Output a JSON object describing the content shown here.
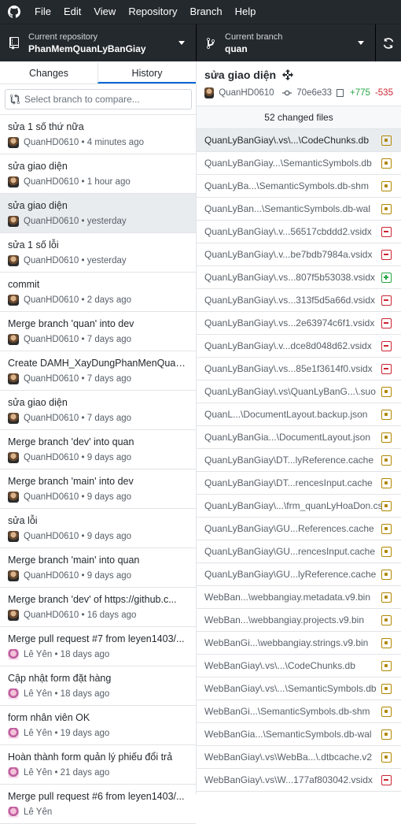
{
  "menu": {
    "items": [
      "File",
      "Edit",
      "View",
      "Repository",
      "Branch",
      "Help"
    ]
  },
  "toolbar": {
    "repo_label": "Current repository",
    "repo_value": "PhanMemQuanLyBanGiay",
    "branch_label": "Current branch",
    "branch_value": "quan"
  },
  "tabs": {
    "changes": "Changes",
    "history": "History"
  },
  "compare": {
    "placeholder": "Select branch to compare..."
  },
  "commits": [
    {
      "title": "sửa 1 số thứ nữa",
      "author": "QuanHD0610",
      "time": "4 minutes ago"
    },
    {
      "title": "sửa giao diện",
      "author": "QuanHD0610",
      "time": "1 hour ago"
    },
    {
      "title": "sửa giao diện",
      "author": "QuanHD0610",
      "time": "yesterday"
    },
    {
      "title": "sửa 1 số lỗi",
      "author": "QuanHD0610",
      "time": "yesterday"
    },
    {
      "title": "commit",
      "author": "QuanHD0610",
      "time": "2 days ago"
    },
    {
      "title": "Merge branch 'quan' into dev",
      "author": "QuanHD0610",
      "time": "7 days ago"
    },
    {
      "title": "Create DAMH_XayDungPhanMenQuan...",
      "author": "QuanHD0610",
      "time": "7 days ago"
    },
    {
      "title": "sửa giao diện",
      "author": "QuanHD0610",
      "time": "7 days ago"
    },
    {
      "title": "Merge branch 'dev' into quan",
      "author": "QuanHD0610",
      "time": "9 days ago"
    },
    {
      "title": "Merge branch 'main' into dev",
      "author": "QuanHD0610",
      "time": "9 days ago"
    },
    {
      "title": "sửa lỗi",
      "author": "QuanHD0610",
      "time": "9 days ago"
    },
    {
      "title": "Merge branch 'main' into quan",
      "author": "QuanHD0610",
      "time": "9 days ago"
    },
    {
      "title": "Merge branch 'dev' of https://github.c...",
      "author": "QuanHD0610",
      "time": "16 days ago"
    },
    {
      "title": "Merge pull request #7 from leyen1403/...",
      "author": "Lê Yên",
      "time": "18 days ago"
    },
    {
      "title": "Cập nhật form đặt hàng",
      "author": "Lê Yên",
      "time": "18 days ago"
    },
    {
      "title": "form nhân viên OK",
      "author": "Lê Yên",
      "time": "19 days ago"
    },
    {
      "title": "Hoàn thành form quản lý phiếu đổi trả",
      "author": "Lê Yên",
      "time": "21 days ago"
    },
    {
      "title": "Merge pull request #6 from leyen1403/...",
      "author": "Lê Yên",
      "time": ""
    }
  ],
  "selected_commit": {
    "title": "sửa giao diện",
    "author": "QuanHD0610",
    "sha": "70e6e33",
    "additions": "+775",
    "deletions": "-535"
  },
  "files_header": "52 changed files",
  "files": [
    {
      "name": "QuanLyBanGiay\\.vs\\...\\CodeChunks.db",
      "status": "modified"
    },
    {
      "name": "QuanLyBanGiay...\\SemanticSymbols.db",
      "status": "modified"
    },
    {
      "name": "QuanLyBa...\\SemanticSymbols.db-shm",
      "status": "modified"
    },
    {
      "name": "QuanLyBan...\\SemanticSymbols.db-wal",
      "status": "modified"
    },
    {
      "name": "QuanLyBanGiay\\.v...56517cbddd2.vsidx",
      "status": "deleted"
    },
    {
      "name": "QuanLyBanGiay\\.v...be7bdb7984a.vsidx",
      "status": "deleted"
    },
    {
      "name": "QuanLyBanGiay\\.vs...807f5b53038.vsidx",
      "status": "added"
    },
    {
      "name": "QuanLyBanGiay\\.vs...313f5d5a66d.vsidx",
      "status": "deleted"
    },
    {
      "name": "QuanLyBanGiay\\.vs...2e63974c6f1.vsidx",
      "status": "deleted"
    },
    {
      "name": "QuanLyBanGiay\\.v...dce8d048d62.vsidx",
      "status": "deleted"
    },
    {
      "name": "QuanLyBanGiay\\.vs...85e1f3614f0.vsidx",
      "status": "deleted"
    },
    {
      "name": "QuanLyBanGiay\\.vs\\QuanLyBanG...\\.suo",
      "status": "modified"
    },
    {
      "name": "QuanL...\\DocumentLayout.backup.json",
      "status": "modified"
    },
    {
      "name": "QuanLyBanGia...\\DocumentLayout.json",
      "status": "modified"
    },
    {
      "name": "QuanLyBanGiay\\DT...lyReference.cache",
      "status": "modified"
    },
    {
      "name": "QuanLyBanGiay\\DT...rencesInput.cache",
      "status": "modified"
    },
    {
      "name": "QuanLyBanGiay\\...\\frm_quanLyHoaDon.cs",
      "status": "modified"
    },
    {
      "name": "QuanLyBanGiay\\GU...References.cache",
      "status": "modified"
    },
    {
      "name": "QuanLyBanGiay\\GU...rencesInput.cache",
      "status": "modified"
    },
    {
      "name": "QuanLyBanGiay\\GU...lyReference.cache",
      "status": "modified"
    },
    {
      "name": "WebBan...\\webbangiay.metadata.v9.bin",
      "status": "modified"
    },
    {
      "name": "WebBan...\\webbangiay.projects.v9.bin",
      "status": "modified"
    },
    {
      "name": "WebBanGi...\\webbangiay.strings.v9.bin",
      "status": "modified"
    },
    {
      "name": "WebBanGiay\\.vs\\...\\CodeChunks.db",
      "status": "modified"
    },
    {
      "name": "WebBanGiay\\.vs\\...\\SemanticSymbols.db",
      "status": "modified"
    },
    {
      "name": "WebBanGi...\\SemanticSymbols.db-shm",
      "status": "modified"
    },
    {
      "name": "WebBanGia...\\SemanticSymbols.db-wal",
      "status": "modified"
    },
    {
      "name": "WebBanGiay\\.vs\\WebBa...\\.dtbcache.v2",
      "status": "modified"
    },
    {
      "name": "WebBanGiay\\.vs\\W...177af803042.vsidx",
      "status": "deleted"
    }
  ]
}
